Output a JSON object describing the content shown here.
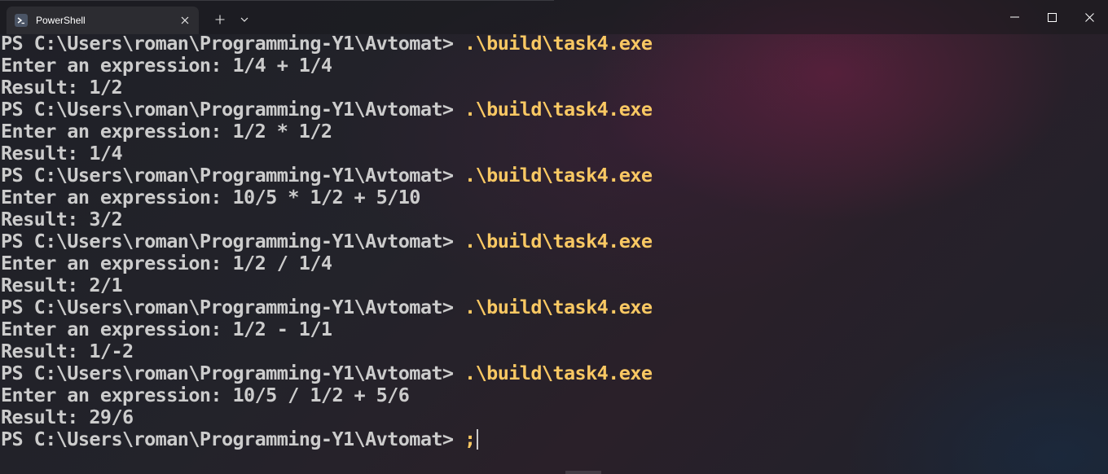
{
  "window": {
    "tab_title": "PowerShell",
    "tab_icon": "powershell-icon",
    "colors": {
      "prompt_text": "#cccccc",
      "command_text": "#f9c863",
      "tab_bg": "#2c2c31"
    }
  },
  "terminal": {
    "prompt": "PS C:\\Users\\roman\\Programming-Y1\\Avtomat>",
    "lines": [
      {
        "kind": "prompt",
        "command": ".\\build\\task4.exe"
      },
      {
        "kind": "output",
        "text": "Enter an expression: 1/4 + 1/4"
      },
      {
        "kind": "output",
        "text": "Result: 1/2"
      },
      {
        "kind": "prompt",
        "command": ".\\build\\task4.exe"
      },
      {
        "kind": "output",
        "text": "Enter an expression: 1/2 * 1/2"
      },
      {
        "kind": "output",
        "text": "Result: 1/4"
      },
      {
        "kind": "prompt",
        "command": ".\\build\\task4.exe"
      },
      {
        "kind": "output",
        "text": "Enter an expression: 10/5 * 1/2 + 5/10"
      },
      {
        "kind": "output",
        "text": "Result: 3/2"
      },
      {
        "kind": "prompt",
        "command": ".\\build\\task4.exe"
      },
      {
        "kind": "output",
        "text": "Enter an expression: 1/2 / 1/4"
      },
      {
        "kind": "output",
        "text": "Result: 2/1"
      },
      {
        "kind": "prompt",
        "command": ".\\build\\task4.exe"
      },
      {
        "kind": "output",
        "text": "Enter an expression: 1/2 - 1/1"
      },
      {
        "kind": "output",
        "text": "Result: 1/-2"
      },
      {
        "kind": "prompt",
        "command": ".\\build\\task4.exe"
      },
      {
        "kind": "output",
        "text": "Enter an expression: 10/5 / 1/2 + 5/6"
      },
      {
        "kind": "output",
        "text": "Result: 29/6"
      },
      {
        "kind": "prompt",
        "command": ";"
      }
    ]
  }
}
